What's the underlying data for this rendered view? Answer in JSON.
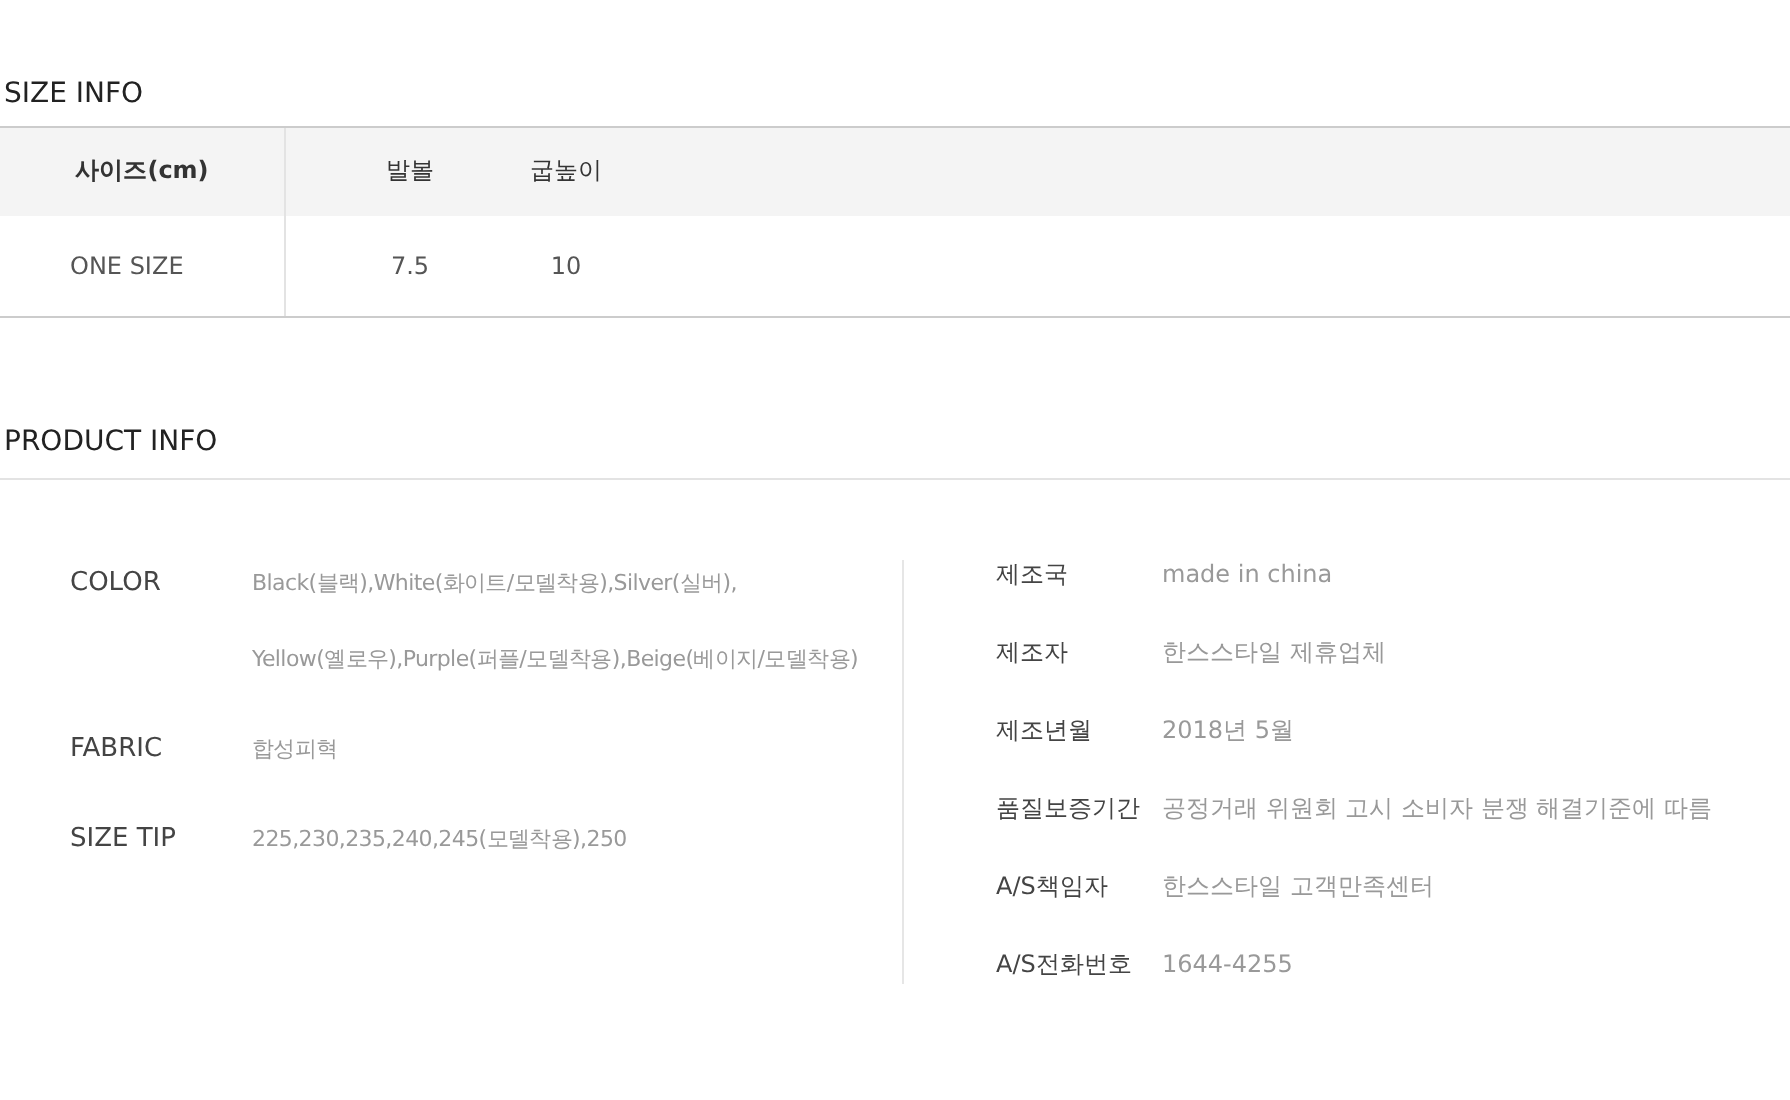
{
  "size_info": {
    "title": "SIZE INFO",
    "columns": [
      "사이즈(cm)",
      "발볼",
      "굽높이"
    ],
    "rows": [
      [
        "ONE SIZE",
        "7.5",
        "10"
      ]
    ]
  },
  "product_info": {
    "title": "PRODUCT INFO",
    "left": [
      {
        "label": "COLOR",
        "lines": [
          "Black(블랙),White(화이트/모델착용),Silver(실버),",
          "Yellow(옐로우),Purple(퍼플/모델착용),Beige(베이지/모델착용)"
        ]
      },
      {
        "label": "FABRIC",
        "lines": [
          "합성피혁"
        ]
      },
      {
        "label": "SIZE TIP",
        "lines": [
          "225,230,235,240,245(모델착용),250"
        ]
      }
    ],
    "right": [
      {
        "label": "제조국",
        "value": "made in china"
      },
      {
        "label": "제조자",
        "value": "한스스타일 제휴업체"
      },
      {
        "label": "제조년월",
        "value": "2018년 5월"
      },
      {
        "label": "품질보증기간",
        "value": "공정거래 위원회 고시 소비자 분쟁 해결기준에 따름"
      },
      {
        "label": "A/S책임자",
        "value": "한스스타일 고객만족센터"
      },
      {
        "label": "A/S전화번호",
        "value": "1644-4255"
      }
    ]
  }
}
